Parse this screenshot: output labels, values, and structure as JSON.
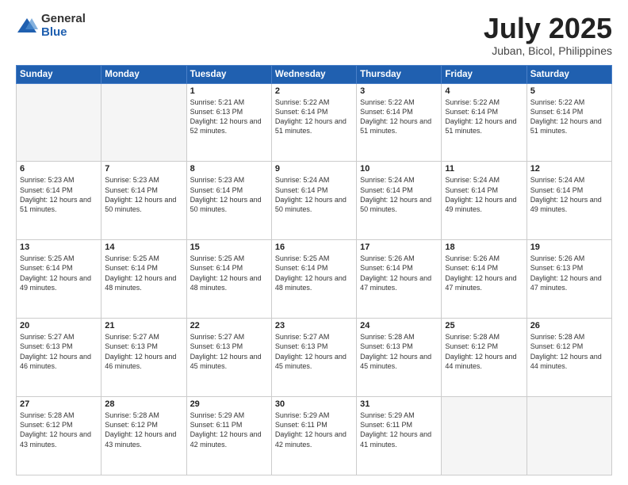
{
  "logo": {
    "general": "General",
    "blue": "Blue"
  },
  "header": {
    "month": "July 2025",
    "location": "Juban, Bicol, Philippines"
  },
  "weekdays": [
    "Sunday",
    "Monday",
    "Tuesday",
    "Wednesday",
    "Thursday",
    "Friday",
    "Saturday"
  ],
  "weeks": [
    [
      {
        "day": "",
        "info": ""
      },
      {
        "day": "",
        "info": ""
      },
      {
        "day": "1",
        "info": "Sunrise: 5:21 AM\nSunset: 6:13 PM\nDaylight: 12 hours and 52 minutes."
      },
      {
        "day": "2",
        "info": "Sunrise: 5:22 AM\nSunset: 6:14 PM\nDaylight: 12 hours and 51 minutes."
      },
      {
        "day": "3",
        "info": "Sunrise: 5:22 AM\nSunset: 6:14 PM\nDaylight: 12 hours and 51 minutes."
      },
      {
        "day": "4",
        "info": "Sunrise: 5:22 AM\nSunset: 6:14 PM\nDaylight: 12 hours and 51 minutes."
      },
      {
        "day": "5",
        "info": "Sunrise: 5:22 AM\nSunset: 6:14 PM\nDaylight: 12 hours and 51 minutes."
      }
    ],
    [
      {
        "day": "6",
        "info": "Sunrise: 5:23 AM\nSunset: 6:14 PM\nDaylight: 12 hours and 51 minutes."
      },
      {
        "day": "7",
        "info": "Sunrise: 5:23 AM\nSunset: 6:14 PM\nDaylight: 12 hours and 50 minutes."
      },
      {
        "day": "8",
        "info": "Sunrise: 5:23 AM\nSunset: 6:14 PM\nDaylight: 12 hours and 50 minutes."
      },
      {
        "day": "9",
        "info": "Sunrise: 5:24 AM\nSunset: 6:14 PM\nDaylight: 12 hours and 50 minutes."
      },
      {
        "day": "10",
        "info": "Sunrise: 5:24 AM\nSunset: 6:14 PM\nDaylight: 12 hours and 50 minutes."
      },
      {
        "day": "11",
        "info": "Sunrise: 5:24 AM\nSunset: 6:14 PM\nDaylight: 12 hours and 49 minutes."
      },
      {
        "day": "12",
        "info": "Sunrise: 5:24 AM\nSunset: 6:14 PM\nDaylight: 12 hours and 49 minutes."
      }
    ],
    [
      {
        "day": "13",
        "info": "Sunrise: 5:25 AM\nSunset: 6:14 PM\nDaylight: 12 hours and 49 minutes."
      },
      {
        "day": "14",
        "info": "Sunrise: 5:25 AM\nSunset: 6:14 PM\nDaylight: 12 hours and 48 minutes."
      },
      {
        "day": "15",
        "info": "Sunrise: 5:25 AM\nSunset: 6:14 PM\nDaylight: 12 hours and 48 minutes."
      },
      {
        "day": "16",
        "info": "Sunrise: 5:25 AM\nSunset: 6:14 PM\nDaylight: 12 hours and 48 minutes."
      },
      {
        "day": "17",
        "info": "Sunrise: 5:26 AM\nSunset: 6:14 PM\nDaylight: 12 hours and 47 minutes."
      },
      {
        "day": "18",
        "info": "Sunrise: 5:26 AM\nSunset: 6:14 PM\nDaylight: 12 hours and 47 minutes."
      },
      {
        "day": "19",
        "info": "Sunrise: 5:26 AM\nSunset: 6:13 PM\nDaylight: 12 hours and 47 minutes."
      }
    ],
    [
      {
        "day": "20",
        "info": "Sunrise: 5:27 AM\nSunset: 6:13 PM\nDaylight: 12 hours and 46 minutes."
      },
      {
        "day": "21",
        "info": "Sunrise: 5:27 AM\nSunset: 6:13 PM\nDaylight: 12 hours and 46 minutes."
      },
      {
        "day": "22",
        "info": "Sunrise: 5:27 AM\nSunset: 6:13 PM\nDaylight: 12 hours and 45 minutes."
      },
      {
        "day": "23",
        "info": "Sunrise: 5:27 AM\nSunset: 6:13 PM\nDaylight: 12 hours and 45 minutes."
      },
      {
        "day": "24",
        "info": "Sunrise: 5:28 AM\nSunset: 6:13 PM\nDaylight: 12 hours and 45 minutes."
      },
      {
        "day": "25",
        "info": "Sunrise: 5:28 AM\nSunset: 6:12 PM\nDaylight: 12 hours and 44 minutes."
      },
      {
        "day": "26",
        "info": "Sunrise: 5:28 AM\nSunset: 6:12 PM\nDaylight: 12 hours and 44 minutes."
      }
    ],
    [
      {
        "day": "27",
        "info": "Sunrise: 5:28 AM\nSunset: 6:12 PM\nDaylight: 12 hours and 43 minutes."
      },
      {
        "day": "28",
        "info": "Sunrise: 5:28 AM\nSunset: 6:12 PM\nDaylight: 12 hours and 43 minutes."
      },
      {
        "day": "29",
        "info": "Sunrise: 5:29 AM\nSunset: 6:11 PM\nDaylight: 12 hours and 42 minutes."
      },
      {
        "day": "30",
        "info": "Sunrise: 5:29 AM\nSunset: 6:11 PM\nDaylight: 12 hours and 42 minutes."
      },
      {
        "day": "31",
        "info": "Sunrise: 5:29 AM\nSunset: 6:11 PM\nDaylight: 12 hours and 41 minutes."
      },
      {
        "day": "",
        "info": ""
      },
      {
        "day": "",
        "info": ""
      }
    ]
  ]
}
